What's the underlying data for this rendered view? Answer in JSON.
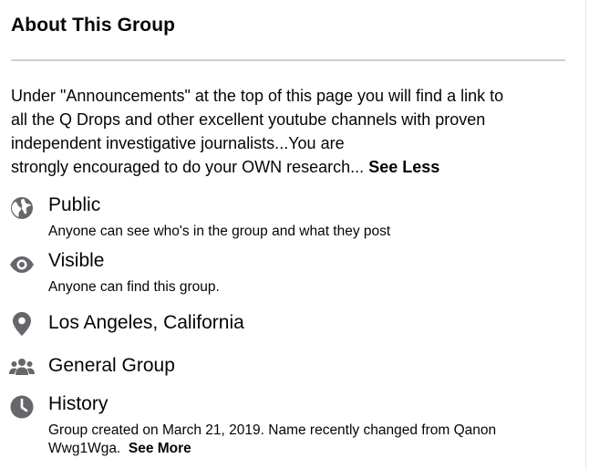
{
  "about": {
    "title": "About This Group",
    "description": "Under \"Announcements\" at the top of this page you will find a link to all the Q Drops and other excellent youtube channels with proven independent investigative journalists...You are strongly encouraged to do your OWN research...",
    "desc_line1": "Under \"Announcements\" at the top of this page you will find a link to",
    "desc_line2": "all the Q Drops and other excellent youtube channels with proven",
    "desc_line3": "independent investigative journalists...You are",
    "desc_line4": "strongly encouraged to do your OWN research...",
    "see_less_label": "See Less"
  },
  "items": {
    "privacy": {
      "icon": "globe-icon",
      "label": "Public",
      "detail": "Anyone can see who's in the group and what they post"
    },
    "visibility": {
      "icon": "eye-icon",
      "label": "Visible",
      "detail": "Anyone can find this group."
    },
    "location": {
      "icon": "location-pin-icon",
      "label": "Los Angeles, California"
    },
    "type": {
      "icon": "people-icon",
      "label": "General Group"
    },
    "history": {
      "icon": "clock-icon",
      "label": "History",
      "detail_line1": "Group created on March 21, 2019. Name recently changed from Qanon",
      "detail_line2": "Wwg1Wga.",
      "see_more_label": "See More"
    }
  },
  "colors": {
    "icon": "#65676b",
    "text": "#050505",
    "divider": "#ced0d4"
  }
}
